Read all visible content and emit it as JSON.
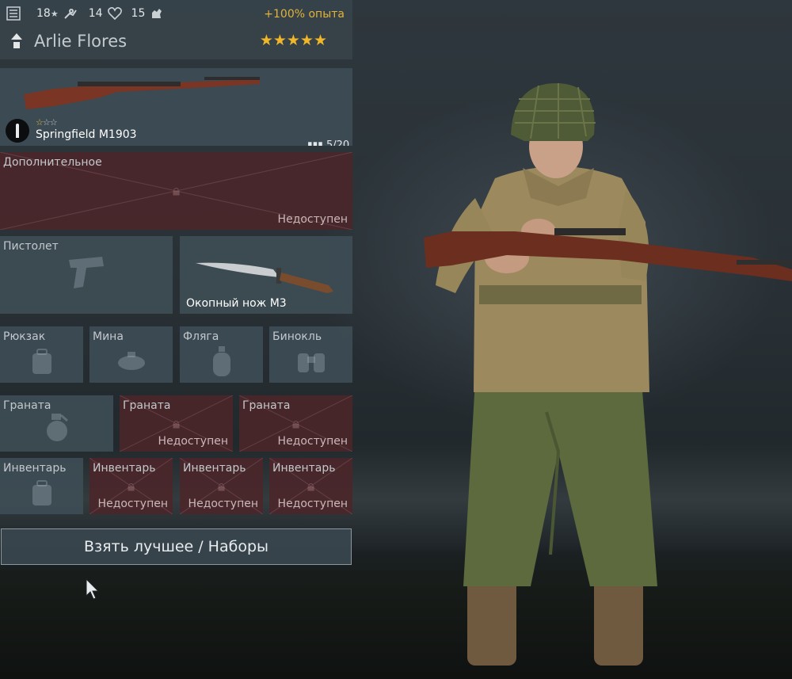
{
  "header": {
    "stat_1": "18",
    "stat_2": "14",
    "stat_3": "15",
    "bonus": "+100% опыта",
    "name": "Arlie Flores",
    "stars": "★★★★★"
  },
  "icons": {
    "list": "list-icon",
    "star": "star-icon",
    "running": "running-icon",
    "heart": "heart-icon",
    "hand": "hand-icon",
    "rank": "rank-chevron-icon",
    "ammo": "ammo-icon",
    "lock": "lock-icon"
  },
  "weapon": {
    "name": "Springfield M1903",
    "ammo": "5/20",
    "rating_on": "☆",
    "rating_off": "☆☆"
  },
  "slots": {
    "extra": {
      "label": "Дополнительное",
      "status": "Недоступен"
    },
    "pistol": {
      "label": "Пистолет"
    },
    "knife": {
      "name": "Окопный нож М3"
    },
    "backpack": {
      "label": "Рюкзак"
    },
    "mine": {
      "label": "Мина"
    },
    "flask": {
      "label": "Фляга"
    },
    "binoculars": {
      "label": "Бинокль"
    },
    "grenade_1": {
      "label": "Граната"
    },
    "grenade_2": {
      "label": "Граната",
      "status": "Недоступен"
    },
    "grenade_3": {
      "label": "Граната",
      "status": "Недоступен"
    },
    "inventory_1": {
      "label": "Инвентарь"
    },
    "inventory_2": {
      "label": "Инвентарь",
      "status": "Недоступен"
    },
    "inventory_3": {
      "label": "Инвентарь",
      "status": "Недоступен"
    },
    "inventory_4": {
      "label": "Инвентарь",
      "status": "Недоступен"
    }
  },
  "best_button": "Взять лучшее / Наборы",
  "colors": {
    "panel": "#3f4d56",
    "locked": "#4c262a",
    "accent_gold": "#e2b33a"
  }
}
